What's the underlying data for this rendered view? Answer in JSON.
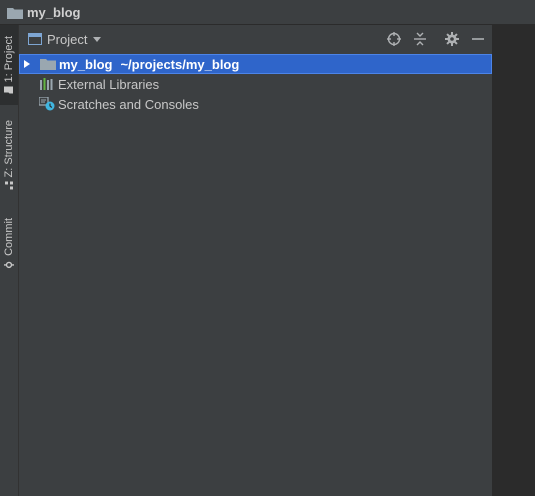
{
  "window": {
    "title": "my_blog"
  },
  "left_strip": {
    "tabs": [
      {
        "label": "1: Project",
        "active": true
      },
      {
        "label": "Z: Structure",
        "active": false
      },
      {
        "label": "Commit",
        "active": false
      }
    ]
  },
  "project_panel": {
    "view_label": "Project",
    "toolbar": {
      "locate_icon": "crosshair-icon",
      "collapse_icon": "collapse-all-icon",
      "settings_icon": "gear-icon",
      "hide_icon": "minimize-icon"
    },
    "tree": [
      {
        "name": "my_blog",
        "path": "~/projects/my_blog",
        "icon": "folder-icon",
        "selected": true,
        "expandable": true
      },
      {
        "name": "External Libraries",
        "icon": "libraries-icon",
        "selected": false,
        "expandable": false
      },
      {
        "name": "Scratches and Consoles",
        "icon": "scratches-icon",
        "selected": false,
        "expandable": false
      }
    ]
  },
  "colors": {
    "background": "#3c3f41",
    "editor_background": "#2b2b2b",
    "selection": "#2f65ca",
    "folder": "#9aa7b0",
    "accent_blue": "#7ea6d3"
  }
}
